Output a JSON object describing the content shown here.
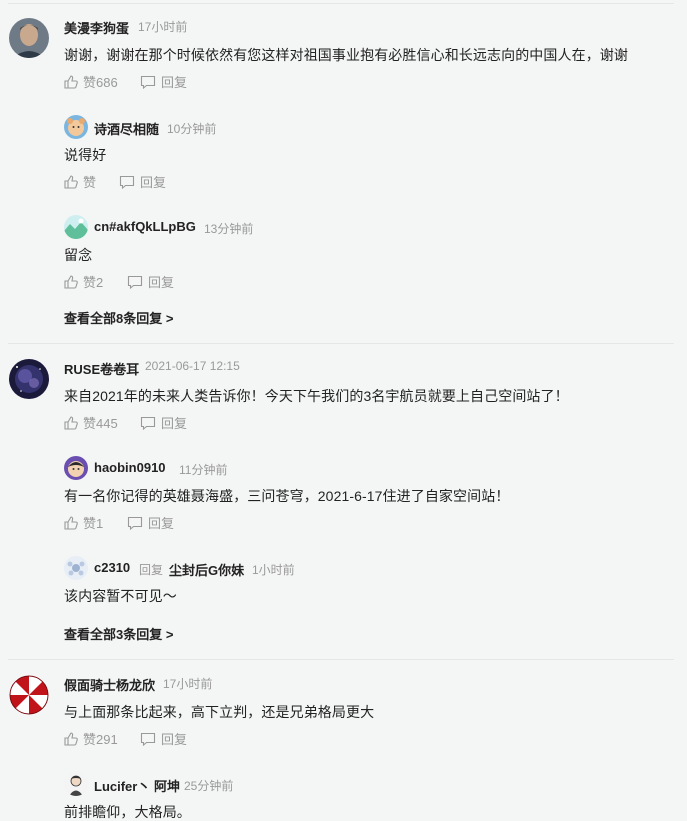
{
  "actions": {
    "like": "赞",
    "reply": "回复"
  },
  "threads": [
    {
      "user": "美漫李狗蛋",
      "time": "17小时前",
      "text": "谢谢，谢谢在那个时候依然有您这样对祖国事业抱有必胜信心和长远志向的中国人在，谢谢",
      "likes": "赞686",
      "reply_label": "回复",
      "replies": [
        {
          "user": "诗酒尽相随",
          "time": "10分钟前",
          "text": "说得好",
          "likes": "赞",
          "reply_label": "回复"
        },
        {
          "user": "cn#akfQkLLpBG",
          "time": "13分钟前",
          "text": "留念",
          "likes": "赞2",
          "reply_label": "回复"
        }
      ],
      "view_all": "查看全部8条回复 >"
    },
    {
      "user": "RUSE卷卷耳",
      "time": "2021-06-17 12:15",
      "text": "来自2021年的未来人类告诉你！今天下午我们的3名宇航员就要上自己空间站了！",
      "likes": "赞445",
      "reply_label": "回复",
      "replies": [
        {
          "user": "haobin0910",
          "time": "11分钟前",
          "text": "有一名你记得的英雄聂海盛，三问苍穹，2021-6-17住进了自家空间站！",
          "likes": "赞1",
          "reply_label": "回复"
        },
        {
          "user": "c2310",
          "reply_word": "回复",
          "reply_to": "尘封后G你妹",
          "time": "1小时前",
          "text": "该内容暂不可见～"
        }
      ],
      "view_all": "查看全部3条回复 >"
    },
    {
      "user": "假面骑士杨龙欣",
      "time": "17小时前",
      "text": "与上面那条比起来，高下立判，还是兄弟格局更大",
      "likes": "赞291",
      "reply_label": "回复",
      "replies": [
        {
          "user": "Lucifer丶 阿坤",
          "time": "25分钟前",
          "text": "前排瞻仰，大格局。"
        }
      ]
    }
  ],
  "colors": {
    "text": "#222222",
    "muted": "#999999",
    "divider": "#e6e6e6",
    "background": "#f4f5f5"
  }
}
